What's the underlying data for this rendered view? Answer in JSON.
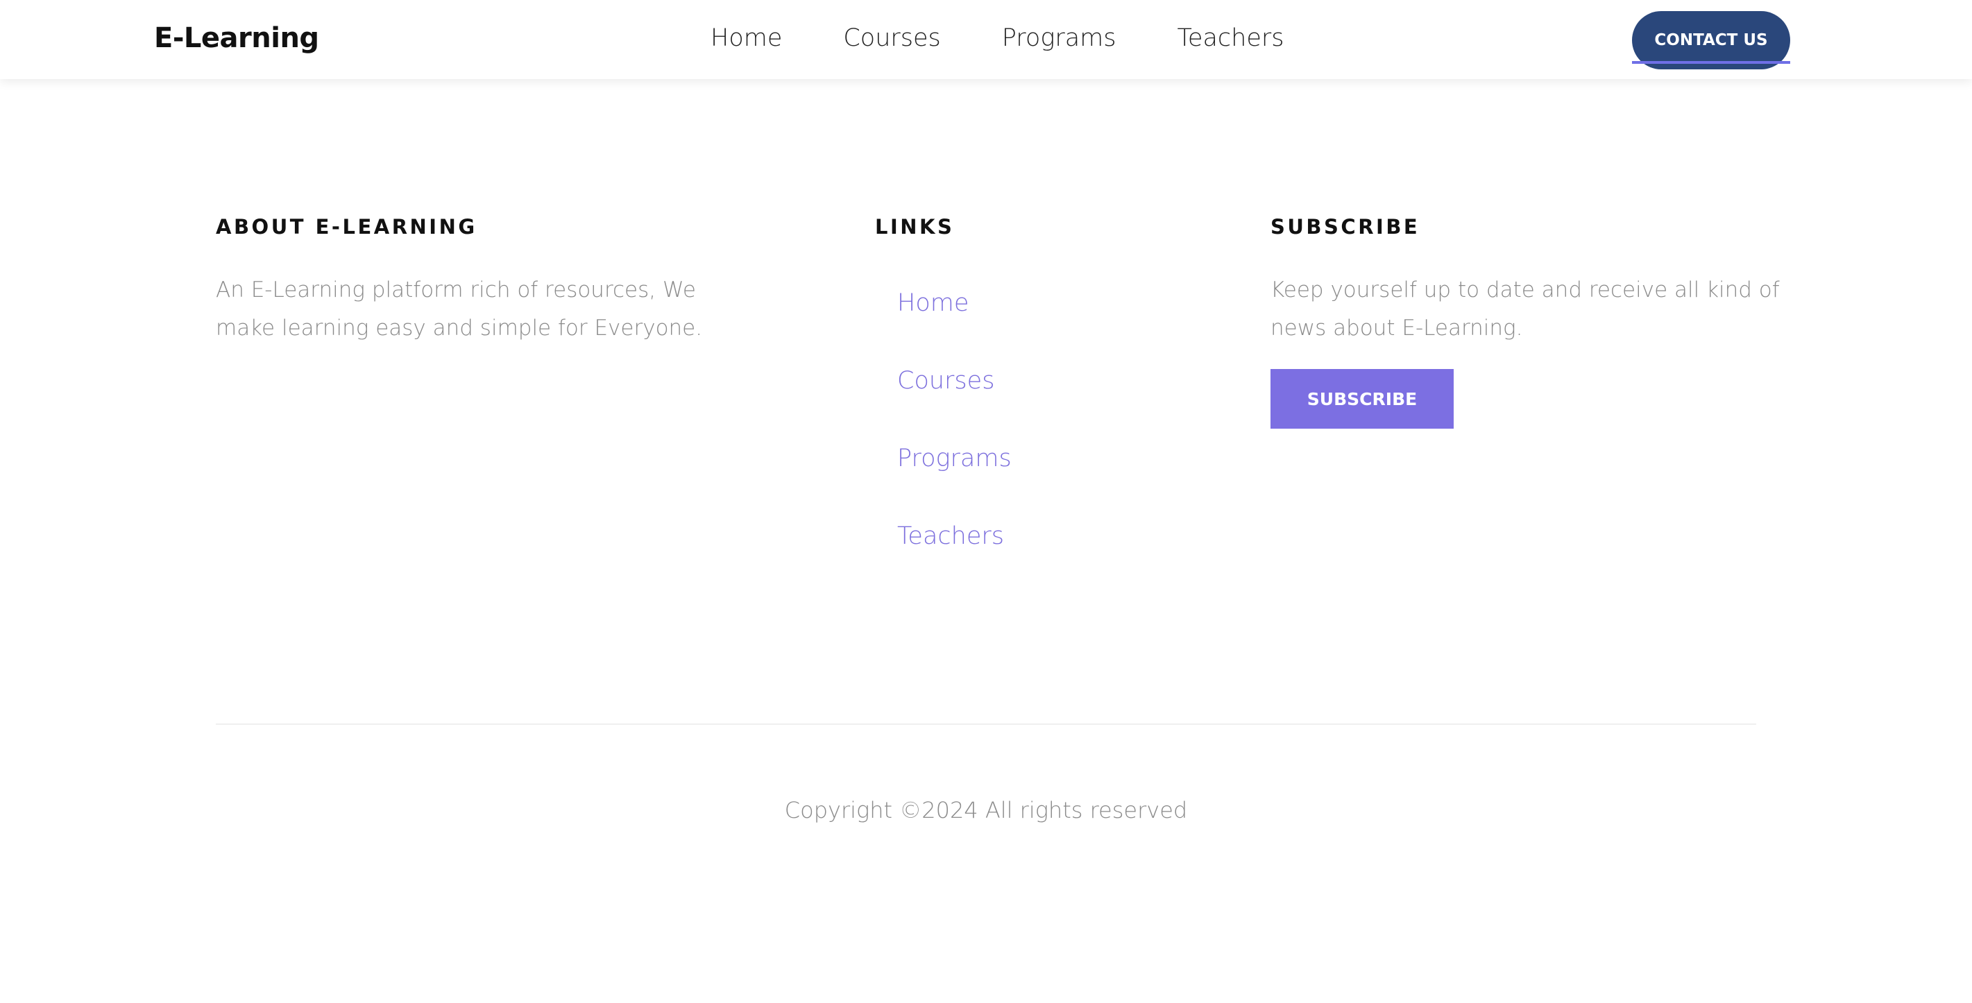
{
  "header": {
    "logo": "E-Learning",
    "nav": [
      "Home",
      "Courses",
      "Programs",
      "Teachers"
    ],
    "contact_label": "CONTACT US"
  },
  "footer": {
    "about": {
      "heading": "ABOUT E-LEARNING",
      "line1": "An E-Learning platform rich of resources, We",
      "line2": "make learning easy and simple for Everyone."
    },
    "links": {
      "heading": "LINKS",
      "items": [
        "Home",
        "Courses",
        "Programs",
        "Teachers"
      ]
    },
    "subscribe": {
      "heading": "SUBSCRIBE",
      "line1": "Keep yourself up to date and receive all kind of",
      "line2": "news about E-Learning.",
      "button_label": "SUBSCRIBE"
    },
    "copyright": "Copyright ©2024 All rights reserved"
  },
  "colors": {
    "contact_button": "#2a477b",
    "subscribe_button": "#7c6fe2",
    "link": "#7c6fdd",
    "muted_text": "#8a8a8a"
  }
}
